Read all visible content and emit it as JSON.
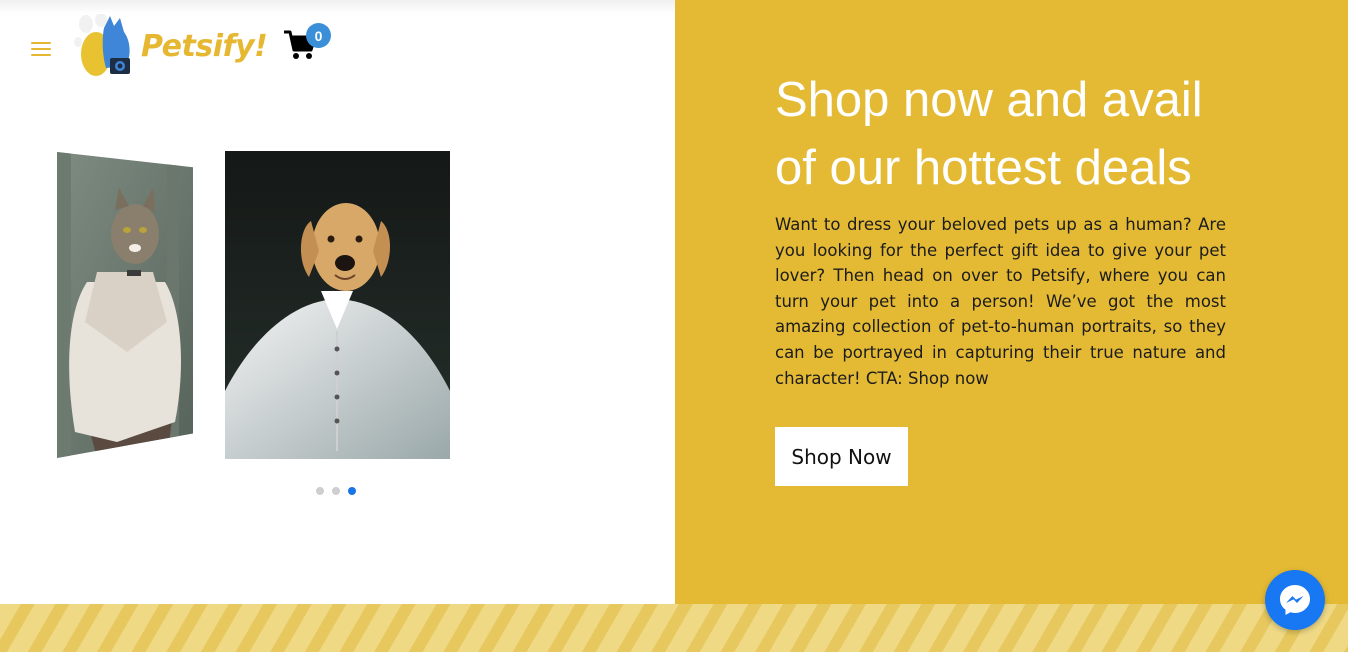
{
  "header": {
    "logo_text": "Petsify!",
    "cart_count": "0",
    "icons": [
      "menu-icon",
      "cart-icon"
    ]
  },
  "carousel": {
    "slides": [
      "cat-portrait",
      "dog-portrait"
    ],
    "dots": 3,
    "active_dot": 3
  },
  "hero": {
    "title": "Shop now and avail of our hottest deals",
    "body": "Want to dress your beloved pets up as a human? Are you looking for the perfect gift idea to give your pet lover? Then head on over to Petsify, where you can turn your pet into a person! We’ve got the most amazing collection of pet-to-human portraits, so they can be portrayed in capturing their true nature and character! CTA: Shop now",
    "button_label": "Shop Now"
  },
  "colors": {
    "accent_yellow": "#e4ba34",
    "badge_blue": "#3a8fd8",
    "messenger_blue": "#1877f2"
  },
  "chat": {
    "icon": "messenger-icon"
  }
}
